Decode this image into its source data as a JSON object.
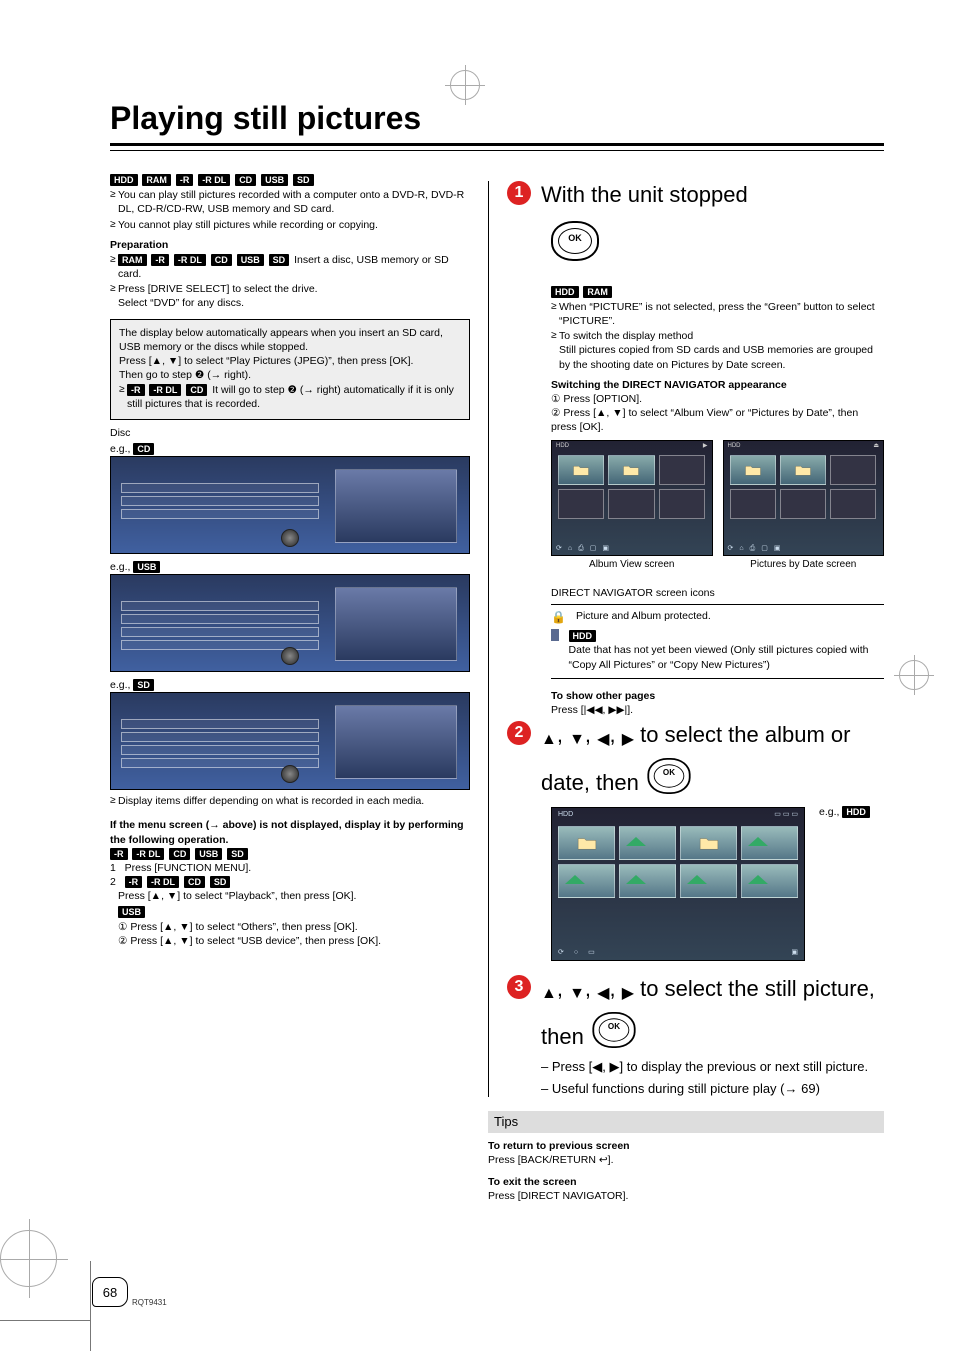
{
  "title": "Playing still pictures",
  "badges_media": [
    "HDD",
    "RAM",
    "-R",
    "-R DL",
    "CD",
    "USB",
    "SD"
  ],
  "intro_bullets": [
    "You can play still pictures recorded with a computer onto a DVD-R, DVD-R DL, CD-R/CD-RW, USB memory and SD card.",
    "You cannot play still pictures while recording or copying."
  ],
  "preparation_heading": "Preparation",
  "prep_badges": [
    "RAM",
    "-R",
    "-R DL",
    "CD",
    "USB",
    "SD"
  ],
  "prep_line1_tail": " Insert a disc, USB memory or SD card.",
  "prep_bullets": [
    "Press [DRIVE SELECT] to select the drive.\nSelect “DVD” for any discs."
  ],
  "graybox": {
    "line1": "The display below automatically appears when you insert an SD card, USB memory or the discs while stopped.",
    "line2": "Press [▲, ▼] to select “Play Pictures (JPEG)”, then press [OK].",
    "line3_pre": "Then go to step ",
    "line3_step": "❷",
    "line3_post": " (→ right).",
    "line4_badges": [
      "-R",
      "-R DL",
      "CD"
    ],
    "line4_rest": " It will go to step ❷ (→ right) automatically if it is only still pictures that is recorded."
  },
  "disc_label": "Disc",
  "eg_cd": "e.g., ",
  "eg_cd_badge": "CD",
  "eg_usb_badge": "USB",
  "eg_sd_badge": "SD",
  "media_note": "Display items differ depending on what is recorded in each media.",
  "menu_fallback": {
    "heading": "If the menu screen (→ above) is not displayed, display it by performing the following operation.",
    "row_badges": [
      "-R",
      "-R DL",
      "CD",
      "USB",
      "SD"
    ],
    "step1_num": "1",
    "step1_text": "Press [FUNCTION MENU].",
    "step2_num": "2",
    "step2_badges": [
      "-R",
      "-R DL",
      "CD",
      "SD"
    ],
    "step2_text": "Press [▲, ▼] to select “Playback”, then press [OK].",
    "usb_badge": "USB",
    "usb_sub1": "① Press [▲, ▼] to select “Others”, then press [OK].",
    "usb_sub2": "② Press [▲, ▼] to select “USB device”, then press [OK]."
  },
  "right": {
    "step1_text": "With the unit stopped",
    "direct_nav_label": "DIRECT NAVIGATOR",
    "hdd_ram_badges": [
      "HDD",
      "RAM"
    ],
    "hdd_ram_bullets": [
      "When “PICTURE” is not selected, press the “Green” button to select “PICTURE”.",
      "To switch the display method\nStill pictures copied from SD cards and USB memories are grouped by the shooting date on Pictures by Date screen."
    ],
    "switch_heading": "Switching the DIRECT NAVIGATOR appearance",
    "switch_step1": "① Press [OPTION].",
    "switch_step2": "② Press [▲, ▼] to select “Album View” or “Pictures by Date”, then press [OK].",
    "caption_album": "Album View screen",
    "caption_date": "Pictures by Date screen",
    "screen_hdr_left1": "HDD",
    "screen_hdr_left2": "▶",
    "screen_hdr_right": "⏏",
    "toolbar_items": [
      "⟳",
      "⌂",
      "⎙",
      "▢",
      "▣"
    ],
    "icons_heading": "DIRECT NAVIGATOR screen icons",
    "icon_lock_text": "Picture and Album protected.",
    "icon_date_badge": "HDD",
    "icon_date_text": "Date that has not yet been viewed (Only still pictures copied with “Copy All Pictures” or “Copy New Pictures”)",
    "other_pages_heading": "To show other pages",
    "other_pages_text": "Press [|◀◀, ▶▶|].",
    "step2_text_a": "▲, ▼, ◀, ▶ to select the album or date, then ",
    "eg_hdd": "e.g., ",
    "eg_hdd_badge": "HDD",
    "bigscreen_hdr_left": "HDD",
    "bigscreen_hdr_mid": "",
    "step3_text_a": "▲, ▼, ◀, ▶ to select the still picture, then ",
    "step3_sub1": "– Press [◀, ▶] to display the previous or next still picture.",
    "step3_sub2": "– Useful functions during still picture play (→ 69)"
  },
  "tips": {
    "heading": "Tips",
    "ret_head": "To return to previous screen",
    "ret_body": "Press [BACK/RETURN ↩].",
    "exit_head": "To exit the screen",
    "exit_body": "Press [DIRECT NAVIGATOR]."
  },
  "page_number": "68",
  "rqt": "RQT9431"
}
